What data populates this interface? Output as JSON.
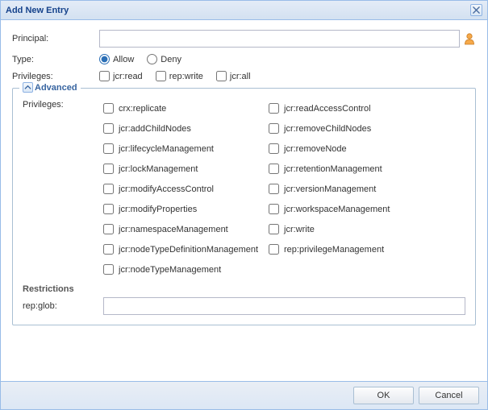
{
  "dialog": {
    "title": "Add New Entry",
    "close_aria": "Close"
  },
  "labels": {
    "principal": "Principal:",
    "type": "Type:",
    "privileges": "Privileges:",
    "advanced": "Advanced",
    "adv_privileges": "Privileges:",
    "restrictions": "Restrictions",
    "rep_glob": "rep:glob:"
  },
  "principal": {
    "value": "",
    "placeholder": ""
  },
  "type": {
    "allow": "Allow",
    "deny": "Deny",
    "selected": "allow"
  },
  "basic_privs": {
    "items": [
      {
        "id": "jcr:read"
      },
      {
        "id": "rep:write"
      },
      {
        "id": "jcr:all"
      }
    ]
  },
  "advanced_privs": {
    "left": [
      "crx:replicate",
      "jcr:addChildNodes",
      "jcr:lifecycleManagement",
      "jcr:lockManagement",
      "jcr:modifyAccessControl",
      "jcr:modifyProperties",
      "jcr:namespaceManagement",
      "jcr:nodeTypeDefinitionManagement",
      "jcr:nodeTypeManagement"
    ],
    "right": [
      "jcr:readAccessControl",
      "jcr:removeChildNodes",
      "jcr:removeNode",
      "jcr:retentionManagement",
      "jcr:versionManagement",
      "jcr:workspaceManagement",
      "jcr:write",
      "rep:privilegeManagement"
    ]
  },
  "restrictions": {
    "rep_glob_value": ""
  },
  "buttons": {
    "ok": "OK",
    "cancel": "Cancel"
  },
  "icons": {
    "user": "user-icon",
    "close": "close-icon",
    "collapse": "chevron-up-icon"
  }
}
